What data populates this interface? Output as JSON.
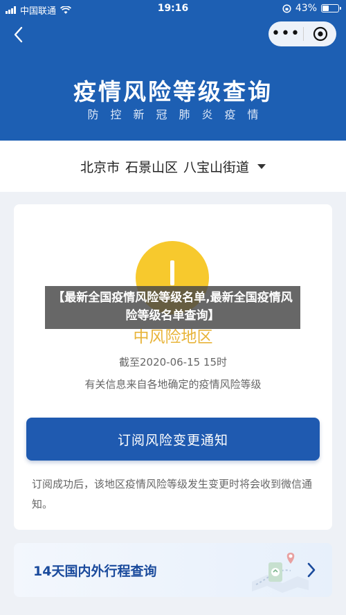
{
  "status_bar": {
    "carrier": "中国联通",
    "time": "19:16",
    "battery": "43%"
  },
  "header": {
    "title": "疫情风险等级查询",
    "subtitle": "防控新冠肺炎疫情"
  },
  "location": {
    "city": "北京市",
    "district": "石景山区",
    "street": "八宝山街道"
  },
  "risk": {
    "level_label": "中风险地区",
    "color": "#f7c92d",
    "as_of": "截至2020-06-15 15时",
    "info_note": "有关信息来自各地确定的疫情风险等级"
  },
  "subscribe": {
    "button_label": "订阅风险变更通知",
    "note": "订阅成功后，该地区疫情风险等级发生变更时将会收到微信通知。"
  },
  "travel": {
    "label": "14天国内外行程查询"
  },
  "overlay": {
    "caption": "【最新全国疫情风险等级名单,最新全国疫情风险等级名单查询】"
  },
  "colors": {
    "header_blue": "#1d5fb3",
    "button_blue": "#1f5ab0",
    "risk_yellow": "#f7c92d"
  }
}
